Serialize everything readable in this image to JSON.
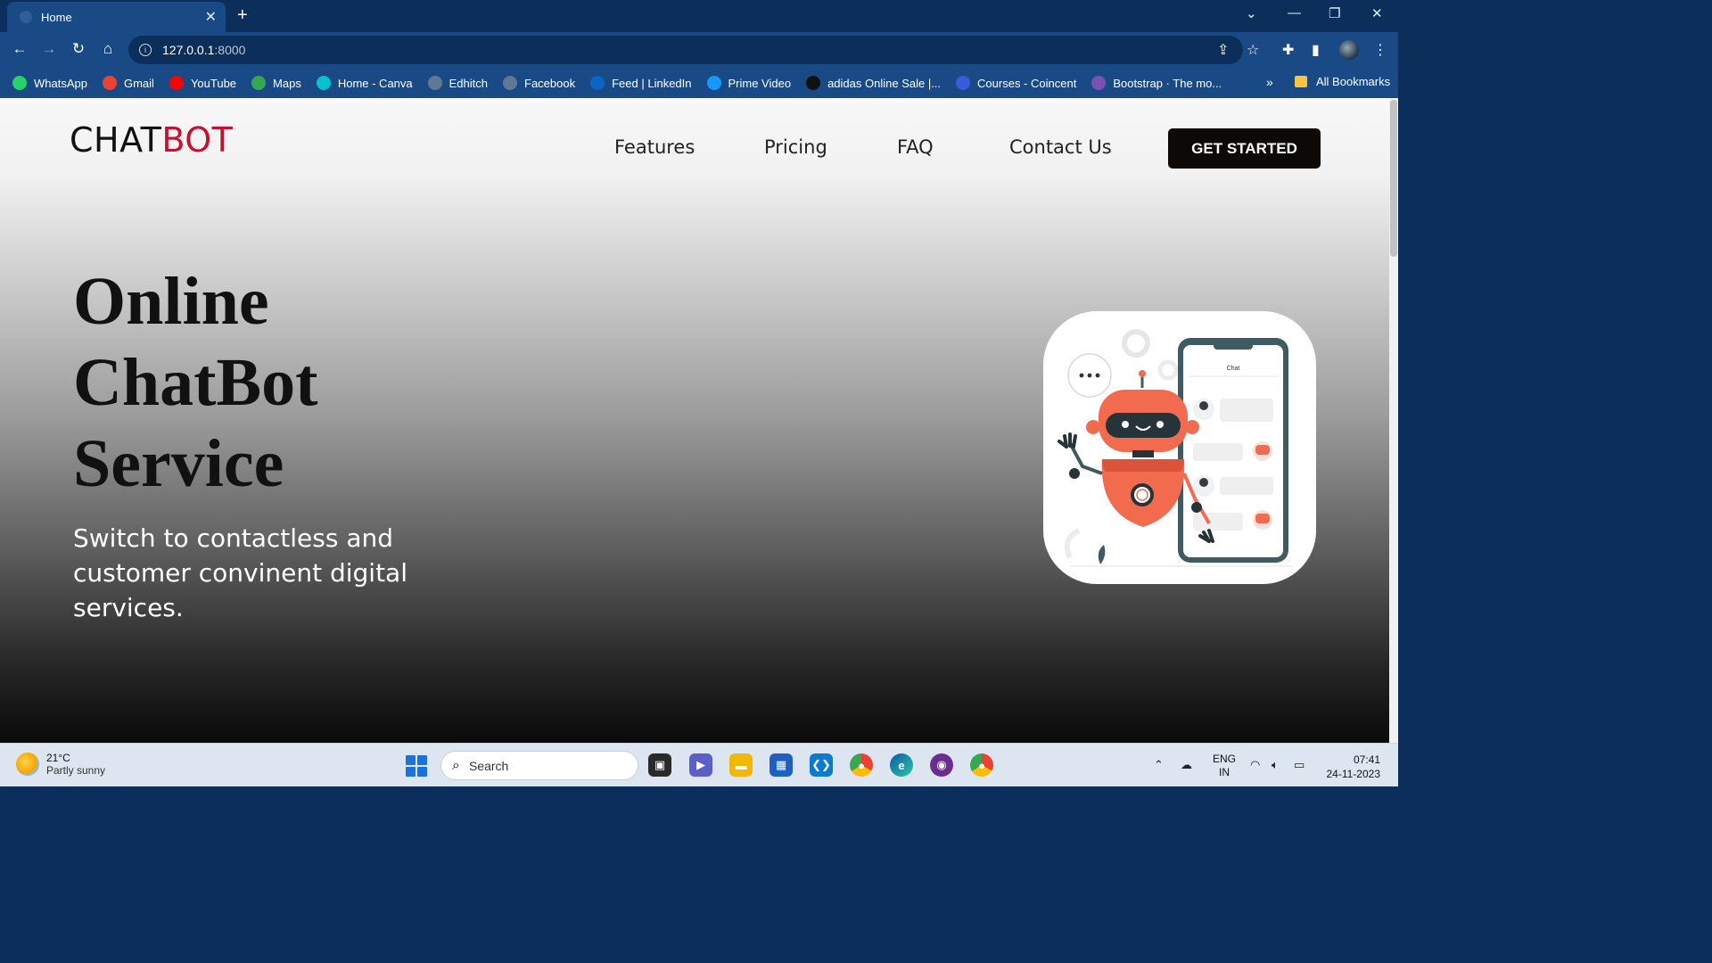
{
  "browser": {
    "tab_title": "Home",
    "new_tab": "+",
    "url_host": "127.0.0.1",
    "url_port": ":8000",
    "bookmarks": [
      {
        "label": "WhatsApp",
        "icon": "whatsapp-icon",
        "color": "#25d366"
      },
      {
        "label": "Gmail",
        "icon": "gmail-icon",
        "color": "#ea4335"
      },
      {
        "label": "YouTube",
        "icon": "youtube-icon",
        "color": "#ff0000"
      },
      {
        "label": "Maps",
        "icon": "maps-icon",
        "color": "#34a853"
      },
      {
        "label": "Home - Canva",
        "icon": "canva-icon",
        "color": "#00c4cc"
      },
      {
        "label": "Edhitch",
        "icon": "globe-icon",
        "color": "#5f7896"
      },
      {
        "label": "Facebook",
        "icon": "globe-icon",
        "color": "#5f7896"
      },
      {
        "label": "Feed | LinkedIn",
        "icon": "linkedin-icon",
        "color": "#0a66c2"
      },
      {
        "label": "Prime Video",
        "icon": "prime-video-icon",
        "color": "#1399ff"
      },
      {
        "label": "adidas Online Sale |...",
        "icon": "adidas-icon",
        "color": "#111111"
      },
      {
        "label": "Courses - Coincent",
        "icon": "coincent-icon",
        "color": "#3a5bd9"
      },
      {
        "label": "Bootstrap · The mo...",
        "icon": "bootstrap-icon",
        "color": "#7952b3"
      }
    ],
    "bookmarks_more": "»",
    "all_bookmarks": "All Bookmarks"
  },
  "page": {
    "logo_part1": "CHAT",
    "logo_part2": "BOT",
    "nav": [
      "Features",
      "Pricing",
      "FAQ",
      "Contact Us"
    ],
    "cta": "GET STARTED",
    "hero_title": "Online ChatBot Service",
    "hero_subtitle": "Switch to contactless and customer convinent digital services.",
    "illustration_chat_label": "Chat"
  },
  "taskbar": {
    "temp": "21°C",
    "weather": "Partly sunny",
    "search_placeholder": "Search",
    "lang_line1": "ENG",
    "lang_line2": "IN",
    "time": "07:41",
    "date": "24-11-2023"
  },
  "colors": {
    "chrome_dark": "#0b2f5a",
    "chrome": "#1a4a86",
    "logo_accent": "#c8102e",
    "cta_bg": "#0d0907",
    "robot": "#f26b4f"
  }
}
